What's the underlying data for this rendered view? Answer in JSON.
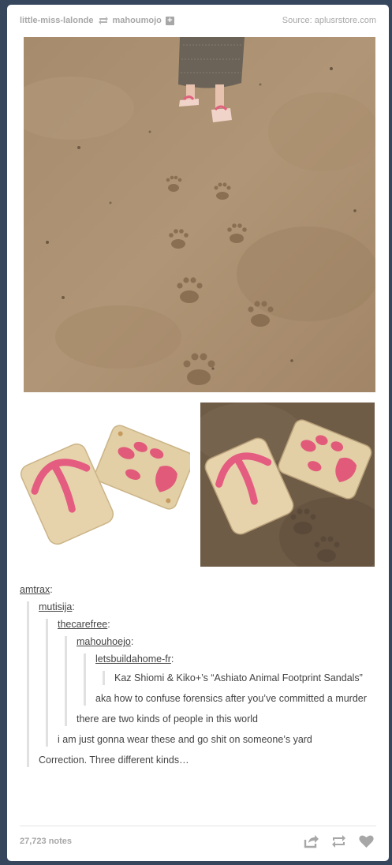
{
  "header": {
    "poster": "little-miss-lalonde",
    "reblogged_from": "mahoumojo",
    "follow_symbol": "+",
    "source_label": "Source:",
    "source": "aplusrstore.com"
  },
  "images": {
    "main_icon": "photo-sand-footprints",
    "left_icon": "photo-sandals-white-bg",
    "right_icon": "photo-sandals-on-sand"
  },
  "thread": {
    "l1_user": "amtrax",
    "l2_user": "mutisija",
    "l3_user": "thecarefree",
    "l4_user": "mahouhoejo",
    "l5_user": "letsbuildahome-fr",
    "l6_text": "Kaz Shiomi & Kiko+’s “Ashiato Animal Footprint Sandals”",
    "l5_text": "aka how to confuse forensics after you’ve committed a murder",
    "l4_text": "there are two kinds of people in this world",
    "l3_text": "i am just gonna wear these and go shit on someone’s yard",
    "l2_text": "Correction.  Three different kinds…",
    "colon": ":"
  },
  "footer": {
    "notes": "27,723 notes",
    "share_icon": "share-icon",
    "reblog_icon": "reblog-icon",
    "like_icon": "heart-icon"
  },
  "colors": {
    "dashboard_bg": "#36465d",
    "post_bg": "#ffffff",
    "meta_text": "#a7a7a7",
    "body_text": "#444444",
    "quote_border": "#e1e1e1"
  }
}
